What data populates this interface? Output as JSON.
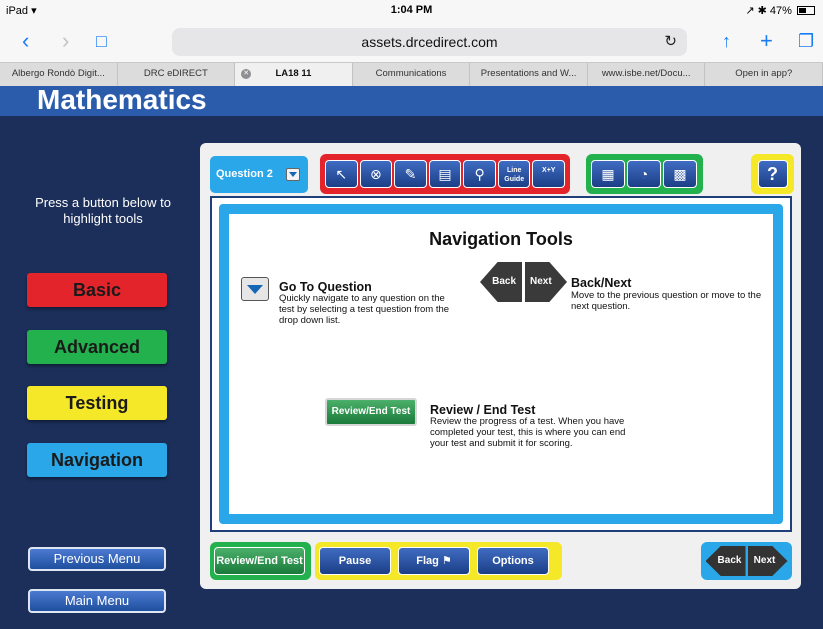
{
  "status": {
    "device": "iPad",
    "time": "1:04 PM",
    "battery": "47%"
  },
  "browser": {
    "url": "assets.drcedirect.com",
    "tabs": [
      "Albergo Rondò Digit...",
      "DRC eDIRECT",
      "LA18 11",
      "Communications",
      "Presentations and W...",
      "www.isbe.net/Docu...",
      "Open in app?"
    ]
  },
  "app": {
    "title": "Mathematics"
  },
  "sidebar": {
    "instructions": "Press a button below to highlight tools",
    "categories": [
      {
        "label": "Basic",
        "color": "#e3252b"
      },
      {
        "label": "Advanced",
        "color": "#22b14c"
      },
      {
        "label": "Testing",
        "color": "#f5e829"
      },
      {
        "label": "Navigation",
        "color": "#2aa7e8"
      }
    ],
    "previous_menu": "Previous Menu",
    "main_menu": "Main Menu"
  },
  "toolbar": {
    "question_label": "Question 2",
    "tools": [
      "pointer-icon",
      "eliminator-icon",
      "highlighter-icon",
      "notepad-icon",
      "magnifier-icon",
      "line-guide-icon",
      "formula-icon"
    ],
    "line_guide_label": "Line Guide",
    "formula_label": "X+Y",
    "math_tools": [
      "calculator-icon",
      "protractor-icon",
      "grid-icon"
    ],
    "help_label": "?"
  },
  "content": {
    "title": "Navigation Tools",
    "goto": {
      "title": "Go To Question",
      "desc": "Quickly navigate to any question on the test by selecting a test question from the drop down list."
    },
    "backnext": {
      "title": "Back/Next",
      "desc": "Move to the previous question or move to the next question.",
      "back_label": "Back",
      "next_label": "Next"
    },
    "review": {
      "button_label": "Review/End Test",
      "title": "Review / End Test",
      "desc": "Review the progress of a test. When you have completed your test, this is where you can end your test and submit it for scoring."
    }
  },
  "bottombar": {
    "review_label": "Review/End Test",
    "pause_label": "Pause",
    "flag_label": "Flag",
    "options_label": "Options",
    "back_label": "Back",
    "next_label": "Next"
  }
}
